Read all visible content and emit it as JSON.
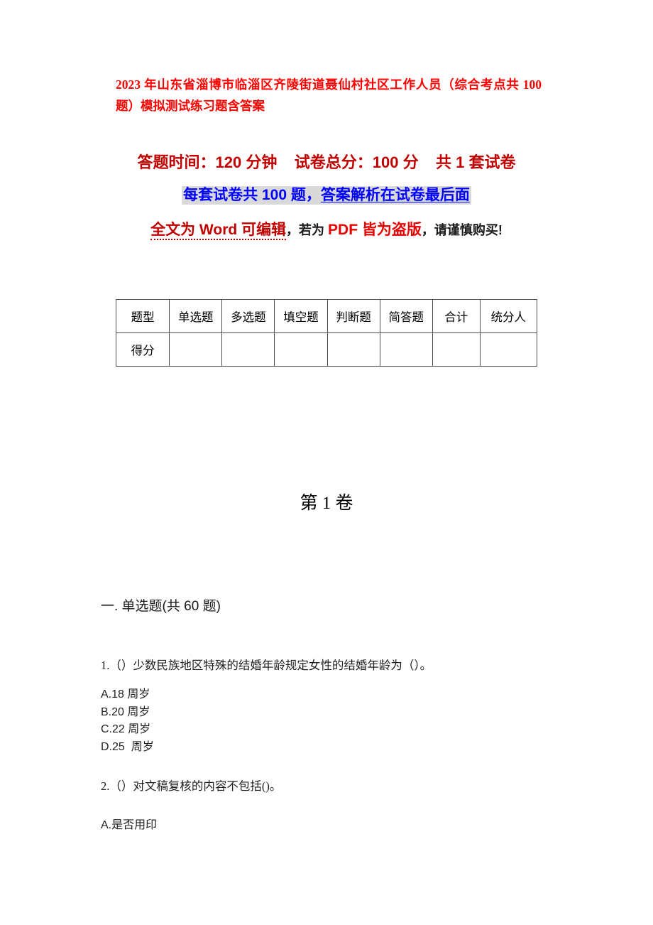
{
  "document": {
    "title": "2023 年山东省淄博市临淄区齐陵街道聂仙村社区工作人员（综合考点共 100 题）模拟测试练习题含答案",
    "exam_info": {
      "line1": "答题时间：120 分钟    试卷总分：100 分    共 1 套试卷",
      "line2_part1": "每套试卷共 100 题，",
      "line2_part2": "答案解析在试卷最后面",
      "line3_part1": "全文为 Word 可编辑",
      "line3_part2": "，若为 ",
      "line3_part3": "PDF 皆为盗版",
      "line3_part4": "，请谨慎购买!"
    },
    "paper_label": "第 1 卷",
    "section_heading": "一. 单选题(共 60 题)"
  },
  "score_table": {
    "headers": [
      "题型",
      "单选题",
      "多选题",
      "填空题",
      "判断题",
      "简答题",
      "合计",
      "统分人"
    ],
    "rows": [
      {
        "label": "得分",
        "values": [
          "",
          "",
          "",
          "",
          "",
          "",
          ""
        ]
      }
    ]
  },
  "questions": [
    {
      "stem": "1.（）少数民族地区特殊的结婚年龄规定女性的结婚年龄为（）。",
      "options": [
        "A.18 周岁",
        "B.20 周岁",
        "C.22 周岁",
        "D.25  周岁"
      ]
    },
    {
      "stem": "2.（）对文稿复核的内容不包括()。",
      "options": [
        "A.是否用印"
      ]
    }
  ],
  "colors": {
    "title_red": "#ff0000",
    "info_dark_red": "#c00000",
    "info_blue": "#0000ff",
    "highlight_gray": "#d9d9d9",
    "bright_red": "#e60000",
    "body_text": "#1f1f1f",
    "table_border": "#4d4d4d"
  }
}
